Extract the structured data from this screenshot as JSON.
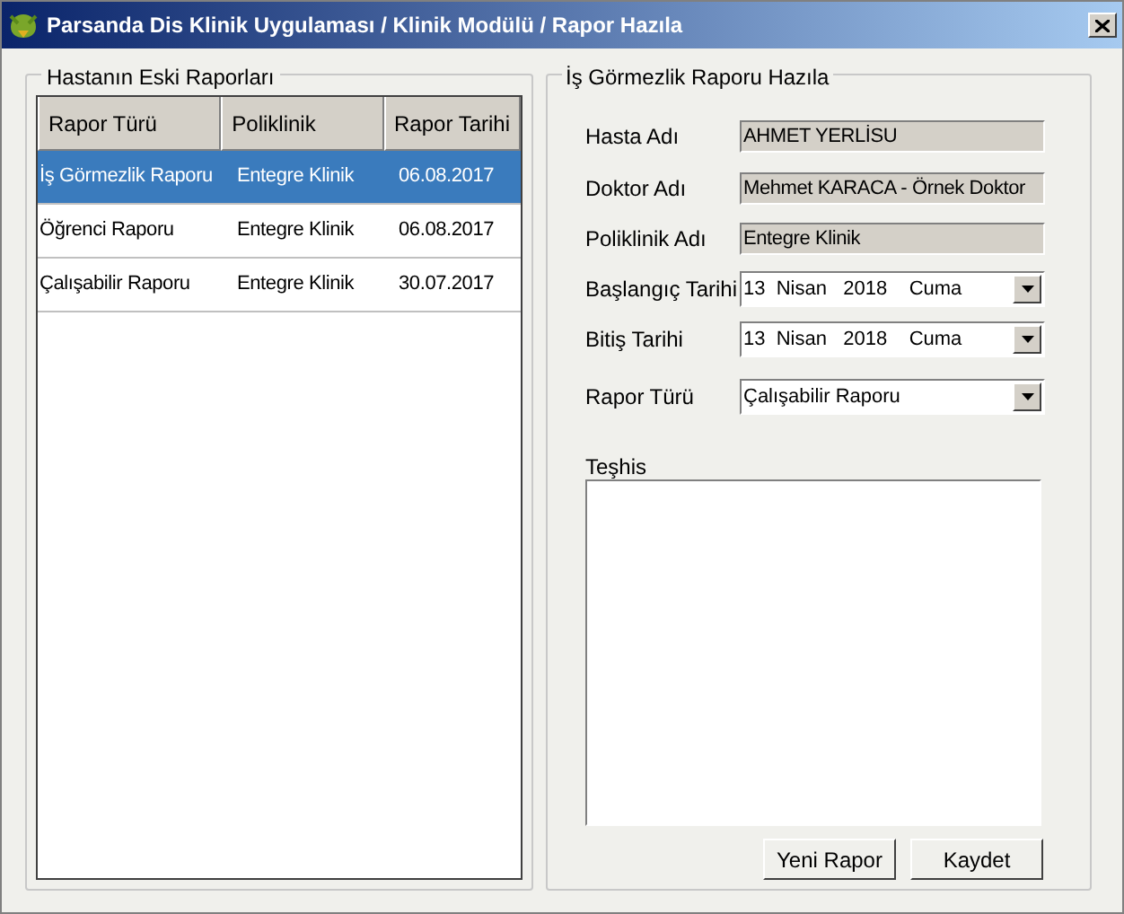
{
  "window": {
    "title": "Parsanda Dis Klinik Uygulaması / Klinik Modülü / Rapor Hazıla"
  },
  "history": {
    "title": "Hastanın Eski Raporları",
    "columns": [
      "Rapor Türü",
      "Poliklinik",
      "Rapor Tarihi"
    ],
    "rows": [
      {
        "cells": [
          "İş Görmezlik Raporu",
          "Entegre Klinik",
          "06.08.2017"
        ],
        "selected": true
      },
      {
        "cells": [
          "Öğrenci Raporu",
          "Entegre Klinik",
          "06.08.2017"
        ],
        "selected": false
      },
      {
        "cells": [
          "Çalışabilir Raporu",
          "Entegre Klinik",
          "30.07.2017"
        ],
        "selected": false
      }
    ]
  },
  "form": {
    "title": "İş Görmezlik Raporu Hazıla",
    "fields": [
      {
        "label": "Hasta Adı",
        "kind": "text",
        "value": "AHMET YERLİSU"
      },
      {
        "label": "Doktor Adı",
        "kind": "text",
        "value": "Mehmet KARACA - Örnek Doktor"
      },
      {
        "label": "Poliklinik Adı",
        "kind": "text",
        "value": "Entegre Klinik"
      },
      {
        "label": "Başlangıç Tarihi",
        "kind": "dropdown",
        "value": "13  Nisan   2018    Cuma"
      },
      {
        "label": "Bitiş Tarihi",
        "kind": "dropdown",
        "value": "13  Nisan   2018    Cuma"
      },
      {
        "label": "Rapor Türü",
        "kind": "dropdown",
        "value": "Çalışabilir Raporu"
      }
    ],
    "diagnosis_label": "Teşhis",
    "buttons": [
      "Yeni Rapor",
      "Kaydet"
    ]
  }
}
